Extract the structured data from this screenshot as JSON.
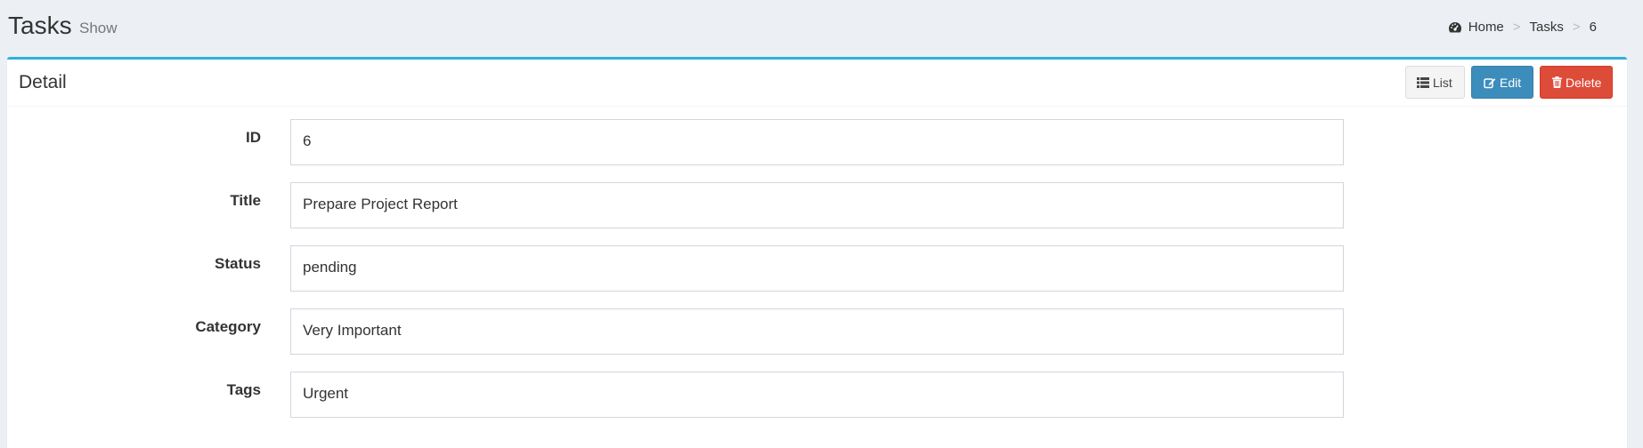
{
  "header": {
    "title": "Tasks",
    "subtitle": "Show"
  },
  "breadcrumb": {
    "icon": "dashboard-icon",
    "items": [
      "Home",
      "Tasks",
      "6"
    ],
    "separator": ">"
  },
  "panel": {
    "title": "Detail",
    "buttons": {
      "list_label": "List",
      "edit_label": "Edit",
      "delete_label": "Delete"
    }
  },
  "fields": [
    {
      "label": "ID",
      "value": "6"
    },
    {
      "label": "Title",
      "value": "Prepare Project Report"
    },
    {
      "label": "Status",
      "value": "pending"
    },
    {
      "label": "Category",
      "value": "Very Important"
    },
    {
      "label": "Tags",
      "value": "Urgent"
    }
  ],
  "colors": {
    "accent": "#3c8dbc",
    "danger": "#dd4b39",
    "box_top_border": "#2fb0d8",
    "background": "#ecf0f5"
  }
}
